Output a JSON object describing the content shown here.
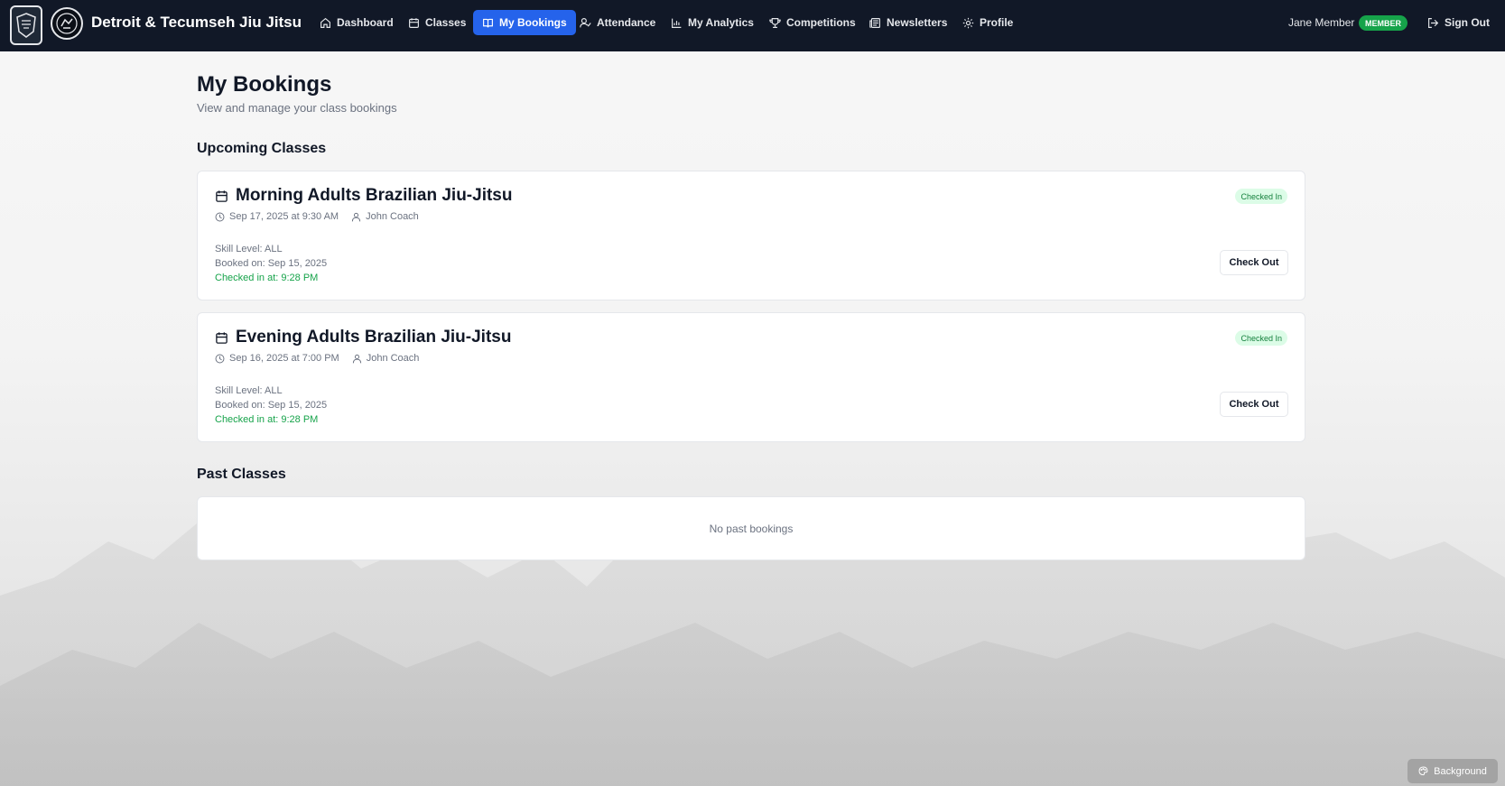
{
  "app": {
    "brand": "Detroit & Tecumseh Jiu Jitsu"
  },
  "nav": {
    "items": [
      {
        "label": "Dashboard",
        "icon": "home-icon"
      },
      {
        "label": "Classes",
        "icon": "calendar-icon"
      },
      {
        "label": "My Bookings",
        "icon": "book-icon",
        "active": true
      },
      {
        "label": "Attendance",
        "icon": "user-check-icon"
      },
      {
        "label": "My Analytics",
        "icon": "bar-chart-icon"
      },
      {
        "label": "Competitions",
        "icon": "trophy-icon"
      },
      {
        "label": "Newsletters",
        "icon": "newspaper-icon"
      },
      {
        "label": "Profile",
        "icon": "gear-icon"
      }
    ],
    "user_name": "Jane Member",
    "role_badge": "MEMBER",
    "sign_out": "Sign Out"
  },
  "page": {
    "title": "My Bookings",
    "subtitle": "View and manage your class bookings"
  },
  "upcoming": {
    "heading": "Upcoming Classes",
    "bookings": [
      {
        "title": "Morning Adults Brazilian Jiu-Jitsu",
        "datetime": "Sep 17, 2025 at 9:30 AM",
        "coach": "John Coach",
        "skill": "Skill Level: ALL",
        "booked": "Booked on: Sep 15, 2025",
        "checked_in": "Checked in at: 9:28 PM",
        "status": "Checked In",
        "action": "Check Out"
      },
      {
        "title": "Evening Adults Brazilian Jiu-Jitsu",
        "datetime": "Sep 16, 2025 at 7:00 PM",
        "coach": "John Coach",
        "skill": "Skill Level: ALL",
        "booked": "Booked on: Sep 15, 2025",
        "checked_in": "Checked in at: 9:28 PM",
        "status": "Checked In",
        "action": "Check Out"
      }
    ]
  },
  "past": {
    "heading": "Past Classes",
    "empty": "No past bookings"
  },
  "background_button": "Background",
  "colors": {
    "navbar": "#111827",
    "active_nav": "#2563eb",
    "member_badge": "#16a34a",
    "checked_in_text": "#16a34a",
    "status_badge_bg": "#dcfce7"
  }
}
